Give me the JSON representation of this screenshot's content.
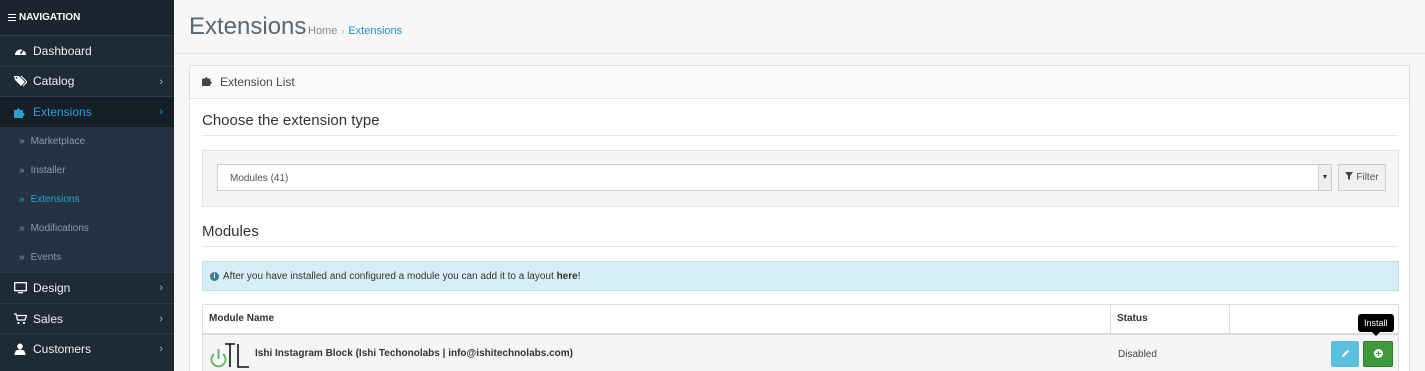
{
  "sidebar": {
    "header": "NAVIGATION",
    "items": [
      {
        "label": "Dashboard",
        "icon": "dashboard-icon",
        "has_children": false
      },
      {
        "label": "Catalog",
        "icon": "tags-icon",
        "has_children": true
      },
      {
        "label": "Extensions",
        "icon": "puzzle-icon",
        "has_children": true,
        "active": true
      },
      {
        "label": "Design",
        "icon": "monitor-icon",
        "has_children": true
      },
      {
        "label": "Sales",
        "icon": "cart-icon",
        "has_children": true
      },
      {
        "label": "Customers",
        "icon": "user-icon",
        "has_children": true
      }
    ],
    "sub_items": [
      {
        "label": "Marketplace"
      },
      {
        "label": "Installer"
      },
      {
        "label": "Extensions",
        "active": true
      },
      {
        "label": "Modifications"
      },
      {
        "label": "Events"
      }
    ]
  },
  "header": {
    "title": "Extensions",
    "breadcrumb": [
      "Home",
      "Extensions"
    ]
  },
  "panel": {
    "title": "Extension List",
    "choose_heading": "Choose the extension type",
    "select_value": "Modules (41)",
    "filter_label": "Filter",
    "modules_heading": "Modules",
    "alert_text": "After you have installed and configured a module you can add it to a layout",
    "alert_link": "here",
    "alert_end": "!"
  },
  "table": {
    "columns": [
      "Module Name",
      "Status"
    ],
    "rows": [
      {
        "name": "Ishi Instagram Block (Ishi Techonolabs | info@ishitechnolabs.com)",
        "status": "Disabled"
      }
    ],
    "tooltip": "Install"
  },
  "colors": {
    "sidebar_bg": "#1e2a36",
    "accent": "#1e91cf",
    "install_green": "#3c9a3c",
    "edit_blue": "#5bc0de",
    "alert_bg": "#d7eef6"
  }
}
